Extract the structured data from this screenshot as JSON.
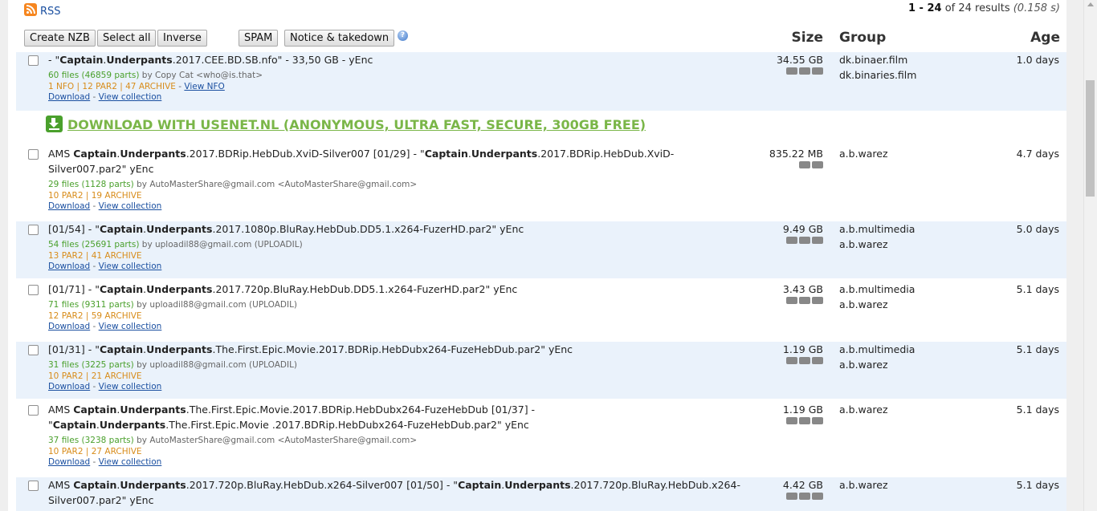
{
  "header": {
    "rss_label": "RSS",
    "results_range": "1 - 24",
    "results_of": " of 24 results ",
    "results_time": "(0.158 s)"
  },
  "toolbar": {
    "create_nzb": "Create NZB",
    "select_all": "Select all",
    "inverse": "Inverse",
    "spam": "SPAM",
    "notice": "Notice & takedown",
    "help": "?"
  },
  "columns": {
    "size": "Size",
    "group": "Group",
    "age": "Age"
  },
  "promo": {
    "text": "DOWNLOAD WITH USENET.NL (ANONYMOUS, ULTRA FAST, SECURE, 300GB FREE)"
  },
  "rows": [
    {
      "title_html": "- \"<b>Captain</b>.<b>Underpants</b>.2017.CEE.BD.SB.nfo\" - 33,50 GB - yEnc",
      "files": "60 files (46859 parts)",
      "poster": " by Copy Cat <who@is.that>",
      "extras": "1 NFO | 12 PAR2 | 47 ARCHIVE",
      "view_nfo": "View NFO",
      "download": "Download",
      "view_collection": "View collection",
      "size": "34.55 GB",
      "groups": [
        "dk.binaer.film",
        "dk.binaries.film"
      ],
      "age": "1.0 days"
    },
    {
      "title_html": "AMS <b>Captain</b>.<b>Underpants</b>.2017.BDRip.HebDub.XviD-Silver007 [01/29] - \"<b>Captain</b>.<b>Underpants</b>.2017.BDRip.HebDub.XviD-Silver007.par2\" yEnc",
      "files": "29 files (1128 parts)",
      "poster": " by AutoMasterShare@gmail.com <AutoMasterShare@gmail.com>",
      "extras": "10 PAR2 | 19 ARCHIVE",
      "download": "Download",
      "view_collection": "View collection",
      "size": "835.22 MB",
      "groups": [
        "a.b.warez"
      ],
      "age": "4.7 days"
    },
    {
      "title_html": "[01/54] - \"<b>Captain</b>.<b>Underpants</b>.2017.1080p.BluRay.HebDub.DD5.1.x264-FuzerHD.par2\" yEnc",
      "files": "54 files (25691 parts)",
      "poster": " by uploadil88@gmail.com (UPLOADIL)",
      "extras": "13 PAR2 | 41 ARCHIVE",
      "download": "Download",
      "view_collection": "View collection",
      "size": "9.49 GB",
      "groups": [
        "a.b.multimedia",
        "a.b.warez"
      ],
      "age": "5.0 days"
    },
    {
      "title_html": "[01/71] - \"<b>Captain</b>.<b>Underpants</b>.2017.720p.BluRay.HebDub.DD5.1.x264-FuzerHD.par2\" yEnc",
      "files": "71 files (9311 parts)",
      "poster": " by uploadil88@gmail.com (UPLOADIL)",
      "extras": "12 PAR2 | 59 ARCHIVE",
      "download": "Download",
      "view_collection": "View collection",
      "size": "3.43 GB",
      "groups": [
        "a.b.multimedia",
        "a.b.warez"
      ],
      "age": "5.1 days"
    },
    {
      "title_html": "[01/31] - \"<b>Captain</b>.<b>Underpants</b>.The.First.Epic.Movie.2017.BDRip.HebDubx264-FuzeHebDub.par2\" yEnc",
      "files": "31 files (3225 parts)",
      "poster": " by uploadil88@gmail.com (UPLOADIL)",
      "extras": "10 PAR2 | 21 ARCHIVE",
      "download": "Download",
      "view_collection": "View collection",
      "size": "1.19 GB",
      "groups": [
        "a.b.multimedia",
        "a.b.warez"
      ],
      "age": "5.1 days"
    },
    {
      "title_html": "AMS <b>Captain</b>.<b>Underpants</b>.The.First.Epic.Movie.2017.BDRip.HebDubx264-FuzeHebDub [01/37] - \"<b>Captain</b>.<b>Underpants</b>.The.First.Epic.Movie .2017.BDRip.HebDubx264-FuzeHebDub.par2\" yEnc",
      "files": "37 files (3238 parts)",
      "poster": " by AutoMasterShare@gmail.com <AutoMasterShare@gmail.com>",
      "extras": "10 PAR2 | 27 ARCHIVE",
      "download": "Download",
      "view_collection": "View collection",
      "size": "1.19 GB",
      "groups": [
        "a.b.warez"
      ],
      "age": "5.1 days"
    },
    {
      "title_html": "AMS <b>Captain</b>.<b>Underpants</b>.2017.720p.BluRay.HebDub.x264-Silver007 [01/50] - \"<b>Captain</b>.<b>Underpants</b>.2017.720p.BluRay.HebDub.x264- Silver007.par2\" yEnc",
      "size": "4.42 GB",
      "groups": [
        "a.b.warez"
      ],
      "age": "5.1 days"
    }
  ]
}
